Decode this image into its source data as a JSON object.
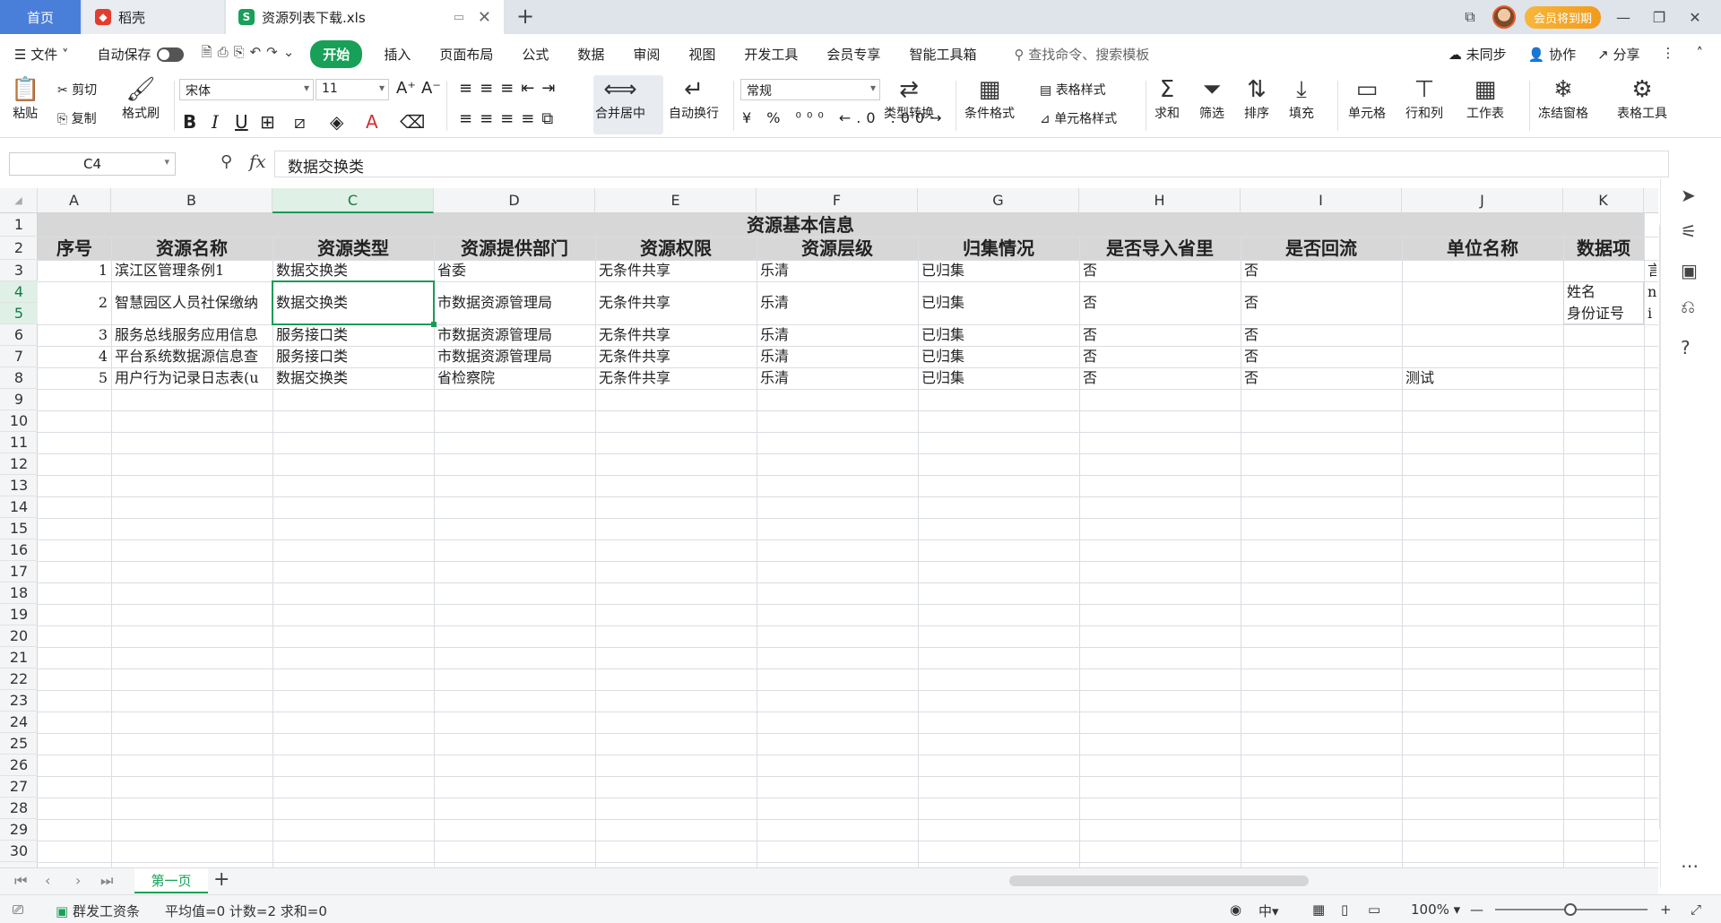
{
  "tabs": {
    "home": "首页",
    "daoke": "稻壳",
    "file": "资源列表下载.xls"
  },
  "topright": {
    "member": "会员将到期"
  },
  "menu": {
    "file": "文件",
    "autosave": "自动保存",
    "start": "开始",
    "items": [
      "插入",
      "页面布局",
      "公式",
      "数据",
      "审阅",
      "视图",
      "开发工具",
      "会员专享",
      "智能工具箱"
    ],
    "search": "查找命令、搜索模板",
    "sync": "未同步",
    "collab": "协作",
    "share": "分享"
  },
  "ribbon": {
    "paste": "粘贴",
    "cut": "剪切",
    "copy": "复制",
    "format_painter": "格式刷",
    "font_name": "宋体",
    "font_size": "11",
    "merge_center": "合并居中",
    "wrap_text": "自动换行",
    "number_format": "常规",
    "type_convert": "类型转换",
    "cond_format": "条件格式",
    "table_style": "表格样式",
    "cell_style": "单元格样式",
    "sum": "求和",
    "filter": "筛选",
    "sort": "排序",
    "fill": "填充",
    "cell": "单元格",
    "row_col": "行和列",
    "worksheet": "工作表",
    "freeze": "冻结窗格",
    "table_tools": "表格工具"
  },
  "formula_bar": {
    "cell_ref": "C4",
    "fx": "fx",
    "content": "数据交换类"
  },
  "columns": [
    "A",
    "B",
    "C",
    "D",
    "E",
    "F",
    "G",
    "H",
    "I",
    "J",
    "K"
  ],
  "sheet": {
    "title": "资源基本信息",
    "headers": [
      "序号",
      "资源名称",
      "资源类型",
      "资源提供部门",
      "资源权限",
      "资源层级",
      "归集情况",
      "是否导入省里",
      "是否回流",
      "单位名称",
      "数据项"
    ],
    "rows": [
      [
        "1",
        "滨江区管理条例1",
        "数据交换类",
        "省委",
        "无条件共享",
        "乐清",
        "已归集",
        "否",
        "否",
        ""
      ],
      [
        "2",
        "智慧园区人员社保缴纳",
        "数据交换类",
        "市数据资源管理局",
        "无条件共享",
        "乐清",
        "已归集",
        "否",
        "否",
        ""
      ],
      [
        "3",
        "服务总线服务应用信息",
        "服务接口类",
        "市数据资源管理局",
        "无条件共享",
        "乐清",
        "已归集",
        "否",
        "否",
        ""
      ],
      [
        "4",
        "平台系统数据源信息查",
        "服务接口类",
        "市数据资源管理局",
        "无条件共享",
        "乐清",
        "已归集",
        "否",
        "否",
        ""
      ],
      [
        "5",
        "用户行为记录日志表(u",
        "数据交换类",
        "省检察院",
        "无条件共享",
        "乐清",
        "已归集",
        "否",
        "否",
        "测试"
      ]
    ],
    "k_items": [
      "姓名",
      "身份证号"
    ],
    "l_items": [
      "n",
      "i"
    ],
    "l_top": "言"
  },
  "sheet_tabs": {
    "current": "第一页"
  },
  "status": {
    "left_label": "群发工资条",
    "stats": "平均值=0  计数=2  求和=0",
    "zoom": "100%"
  }
}
